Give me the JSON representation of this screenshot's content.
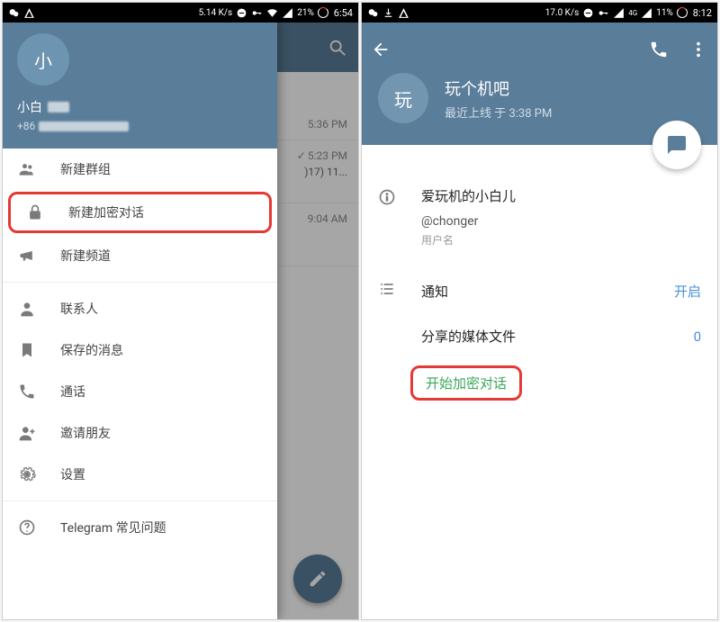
{
  "left": {
    "status": {
      "rate": "5.14 K/s",
      "battery": "21%",
      "time": "6:54"
    },
    "back": {
      "rows": [
        {
          "time": "5:36 PM",
          "extra": ""
        },
        {
          "time": "5:23 PM",
          "extra": ")17) 11..."
        },
        {
          "time": "9:04 AM",
          "extra": ""
        }
      ]
    },
    "drawer": {
      "avatar": "小",
      "name_prefix": "小白",
      "phone_prefix": "+86",
      "menu": {
        "new_group": "新建群组",
        "new_secret_chat": "新建加密对话",
        "new_channel": "新建频道",
        "contacts": "联系人",
        "saved_messages": "保存的消息",
        "calls": "通话",
        "invite": "邀请朋友",
        "settings": "设置",
        "faq": "Telegram 常见问题"
      }
    }
  },
  "right": {
    "status": {
      "rate": "17.0 K/s",
      "net": "4G",
      "battery": "11%",
      "time": "8:12"
    },
    "profile": {
      "avatar": "玩",
      "name": "玩个机吧",
      "status": "最近上线 于 3:38 PM"
    },
    "info": {
      "bio": "爱玩机的小白儿",
      "username": "@chonger",
      "username_label": "用户名"
    },
    "settings": {
      "notifications_label": "通知",
      "notifications_value": "开启",
      "media_label": "分享的媒体文件",
      "media_value": "0",
      "start_secret": "开始加密对话"
    }
  }
}
